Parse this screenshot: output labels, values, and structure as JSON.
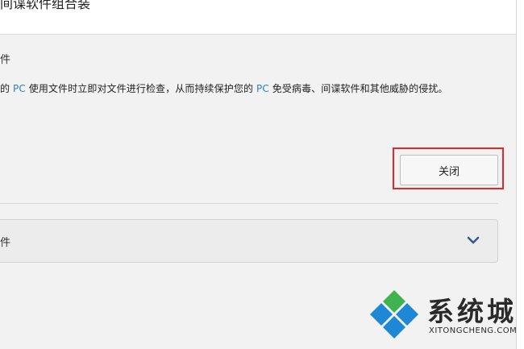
{
  "window": {
    "title": "间谍软件组合装"
  },
  "section": {
    "heading": "件",
    "description_parts": [
      "的 ",
      "PC",
      " 使用文件时立即对文件进行检查，从而持续保护您的 ",
      "PC",
      " 免受病毒、间谍软件和其他威胁的侵扰。"
    ]
  },
  "actions": {
    "close_label": "关闭"
  },
  "expander": {
    "label": "件"
  },
  "watermark": {
    "chinese": "系统城",
    "english": "XITONGCHENG.COM"
  },
  "colors": {
    "accent": "#2f7fc1",
    "highlight_box": "#e02a2a",
    "logo_blue": "#1e88d6",
    "logo_green": "#3fb34f"
  }
}
